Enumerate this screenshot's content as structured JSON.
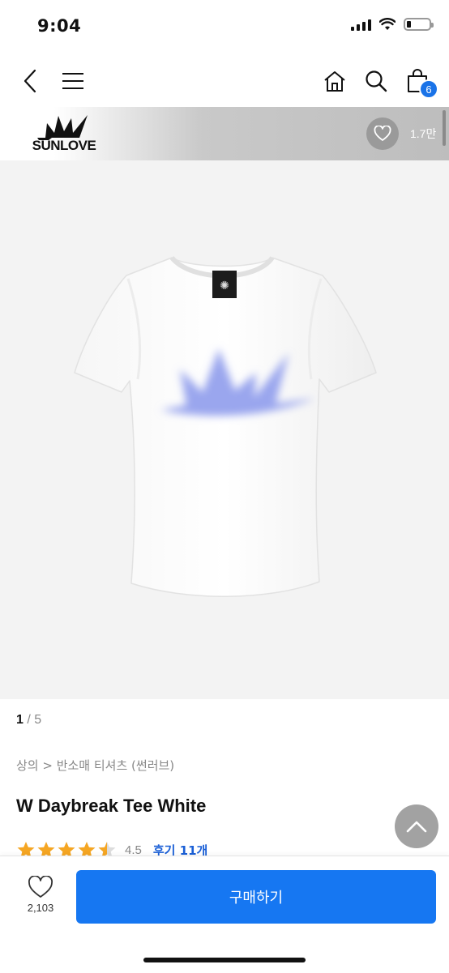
{
  "status": {
    "time": "9:04",
    "battery_level": 0.15
  },
  "nav": {
    "back_icon": "chevron-left-icon",
    "menu_icon": "hamburger-menu-icon",
    "home_icon": "home-icon",
    "search_icon": "search-icon",
    "cart_icon": "shopping-bag-icon",
    "cart_count": "6"
  },
  "brand": {
    "logo_text": "SUNLOVE",
    "like_icon": "heart-outline-icon",
    "like_count": "1.7만"
  },
  "gallery": {
    "current": "1",
    "separator": " / ",
    "total": "5"
  },
  "product": {
    "breadcrumb": "상의 > 반소매 티셔츠 (썬러브)",
    "title": "W Daybreak Tee White",
    "rating_value": "4.5",
    "rating_stars": 4.5,
    "review_link": "후기 11개"
  },
  "bottom": {
    "wish_icon": "heart-outline-icon",
    "wish_count": "2,103",
    "buy_label": "구매하기"
  },
  "colors": {
    "accent": "#1677f2",
    "review_link": "#1a5fd6",
    "star": "#f5a623",
    "shirt_print": "#9aa6ee"
  }
}
